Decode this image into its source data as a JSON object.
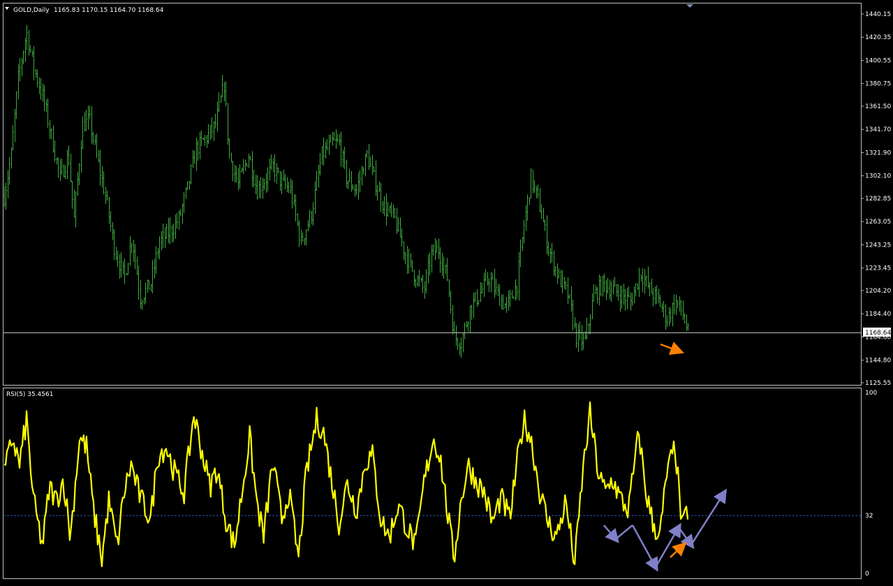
{
  "header": {
    "symbol_label": "GOLD,Daily",
    "ohlc_label": "1165.83 1170.15 1164.70 1168.64",
    "rsi_label": "RSI(5) 35.4561"
  },
  "colors": {
    "background": "#000000",
    "frame": "#c0c0c0",
    "candles": "#3fae3f",
    "rsi_line": "#ffff00",
    "level_line": "#3050c0",
    "annotation_blue": "#8080c8",
    "annotation_orange": "#ff8000"
  },
  "chart_data": [
    {
      "type": "bar",
      "name_label": "GOLD,Daily",
      "price_axis_ticks": [
        "1440.15",
        "1420.35",
        "1400.55",
        "1380.75",
        "1361.50",
        "1341.70",
        "1321.90",
        "1302.10",
        "1282.85",
        "1263.05",
        "1243.25",
        "1223.45",
        "1204.20",
        "1184.40",
        "1164.60",
        "1144.80",
        "1125.55"
      ],
      "ylim": [
        1125.55,
        1446.0
      ],
      "current_price": "1168.64",
      "x_index_range": [
        0,
        980
      ],
      "price_path": [
        [
          0,
          1285
        ],
        [
          10,
          1320
        ],
        [
          20,
          1385
        ],
        [
          32,
          1425
        ],
        [
          42,
          1395
        ],
        [
          55,
          1370
        ],
        [
          68,
          1335
        ],
        [
          80,
          1300
        ],
        [
          92,
          1320
        ],
        [
          100,
          1265
        ],
        [
          112,
          1345
        ],
        [
          122,
          1350
        ],
        [
          132,
          1320
        ],
        [
          145,
          1285
        ],
        [
          158,
          1240
        ],
        [
          172,
          1215
        ],
        [
          183,
          1250
        ],
        [
          195,
          1198
        ],
        [
          210,
          1210
        ],
        [
          222,
          1245
        ],
        [
          238,
          1255
        ],
        [
          250,
          1265
        ],
        [
          262,
          1290
        ],
        [
          275,
          1325
        ],
        [
          290,
          1335
        ],
        [
          302,
          1345
        ],
        [
          315,
          1380
        ],
        [
          322,
          1320
        ],
        [
          335,
          1295
        ],
        [
          350,
          1320
        ],
        [
          362,
          1290
        ],
        [
          375,
          1300
        ],
        [
          385,
          1310
        ],
        [
          398,
          1295
        ],
        [
          410,
          1290
        ],
        [
          425,
          1245
        ],
        [
          440,
          1270
        ],
        [
          455,
          1320
        ],
        [
          470,
          1330
        ],
        [
          480,
          1330
        ],
        [
          490,
          1300
        ],
        [
          505,
          1290
        ],
        [
          520,
          1320
        ],
        [
          530,
          1300
        ],
        [
          545,
          1275
        ],
        [
          560,
          1265
        ],
        [
          575,
          1235
        ],
        [
          590,
          1215
        ],
        [
          602,
          1205
        ],
        [
          612,
          1235
        ],
        [
          622,
          1240
        ],
        [
          635,
          1215
        ],
        [
          645,
          1165
        ],
        [
          655,
          1160
        ],
        [
          668,
          1190
        ],
        [
          680,
          1200
        ],
        [
          695,
          1215
        ],
        [
          708,
          1200
        ],
        [
          720,
          1190
        ],
        [
          735,
          1210
        ],
        [
          745,
          1260
        ],
        [
          755,
          1300
        ],
        [
          768,
          1275
        ],
        [
          780,
          1240
        ],
        [
          795,
          1215
        ],
        [
          808,
          1200
        ],
        [
          820,
          1165
        ],
        [
          832,
          1160
        ],
        [
          845,
          1200
        ],
        [
          858,
          1210
        ],
        [
          872,
          1205
        ],
        [
          885,
          1200
        ],
        [
          898,
          1195
        ],
        [
          912,
          1220
        ],
        [
          925,
          1205
        ],
        [
          938,
          1195
        ],
        [
          950,
          1180
        ],
        [
          962,
          1195
        ],
        [
          972,
          1185
        ],
        [
          980,
          1168
        ]
      ]
    },
    {
      "type": "line",
      "name_label": "RSI(5) 35.4561",
      "rsi_axis_ticks": [
        "100",
        "32",
        "0"
      ],
      "ylim": [
        0,
        100
      ],
      "level": 32,
      "x_index_range": [
        0,
        980
      ],
      "values": [
        [
          0,
          55
        ],
        [
          12,
          75
        ],
        [
          22,
          60
        ],
        [
          32,
          85
        ],
        [
          42,
          40
        ],
        [
          55,
          15
        ],
        [
          65,
          48
        ],
        [
          75,
          40
        ],
        [
          85,
          52
        ],
        [
          95,
          20
        ],
        [
          108,
          75
        ],
        [
          118,
          70
        ],
        [
          128,
          35
        ],
        [
          140,
          8
        ],
        [
          150,
          40
        ],
        [
          162,
          15
        ],
        [
          172,
          45
        ],
        [
          182,
          60
        ],
        [
          195,
          42
        ],
        [
          210,
          30
        ],
        [
          220,
          65
        ],
        [
          232,
          70
        ],
        [
          245,
          55
        ],
        [
          258,
          45
        ],
        [
          272,
          88
        ],
        [
          282,
          70
        ],
        [
          295,
          48
        ],
        [
          305,
          58
        ],
        [
          318,
          30
        ],
        [
          330,
          15
        ],
        [
          342,
          48
        ],
        [
          352,
          75
        ],
        [
          362,
          40
        ],
        [
          372,
          20
        ],
        [
          385,
          62
        ],
        [
          398,
          30
        ],
        [
          408,
          45
        ],
        [
          422,
          8
        ],
        [
          433,
          55
        ],
        [
          448,
          85
        ],
        [
          458,
          78
        ],
        [
          468,
          55
        ],
        [
          480,
          28
        ],
        [
          492,
          50
        ],
        [
          505,
          35
        ],
        [
          518,
          62
        ],
        [
          528,
          65
        ],
        [
          540,
          30
        ],
        [
          552,
          20
        ],
        [
          565,
          38
        ],
        [
          578,
          25
        ],
        [
          590,
          15
        ],
        [
          602,
          50
        ],
        [
          615,
          75
        ],
        [
          625,
          65
        ],
        [
          635,
          35
        ],
        [
          645,
          8
        ],
        [
          655,
          40
        ],
        [
          665,
          60
        ],
        [
          678,
          50
        ],
        [
          688,
          45
        ],
        [
          700,
          28
        ],
        [
          712,
          42
        ],
        [
          725,
          30
        ],
        [
          735,
          60
        ],
        [
          745,
          85
        ],
        [
          755,
          75
        ],
        [
          768,
          45
        ],
        [
          780,
          28
        ],
        [
          792,
          20
        ],
        [
          805,
          40
        ],
        [
          818,
          5
        ],
        [
          830,
          58
        ],
        [
          840,
          88
        ],
        [
          852,
          55
        ],
        [
          862,
          45
        ],
        [
          872,
          52
        ],
        [
          885,
          40
        ],
        [
          895,
          35
        ],
        [
          910,
          78
        ],
        [
          920,
          45
        ],
        [
          930,
          28
        ],
        [
          940,
          20
        ],
        [
          950,
          55
        ],
        [
          962,
          70
        ],
        [
          972,
          25
        ],
        [
          980,
          35
        ]
      ]
    }
  ]
}
